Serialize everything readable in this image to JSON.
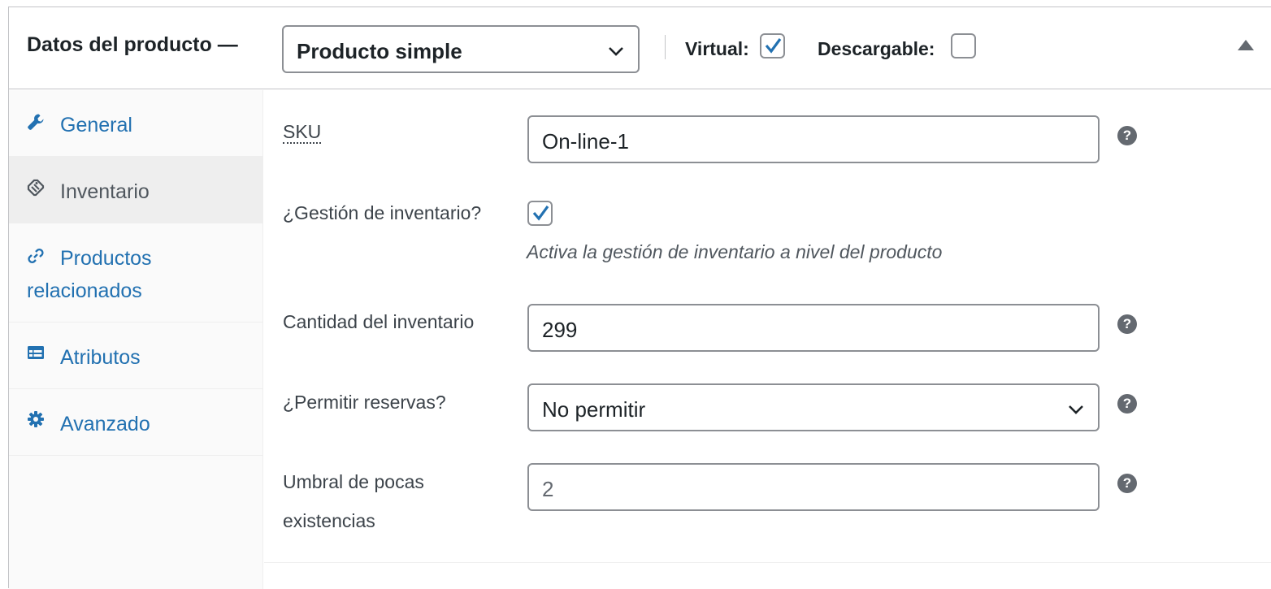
{
  "header": {
    "title": "Datos del producto —",
    "product_type": "Producto simple",
    "virtual_label": "Virtual:",
    "virtual_checked": true,
    "downloadable_label": "Descargable:",
    "downloadable_checked": false
  },
  "tabs": [
    {
      "label": "General",
      "icon": "wrench-icon",
      "active": false
    },
    {
      "label": "Inventario",
      "icon": "tag-icon",
      "active": true
    },
    {
      "label_line1": "Productos",
      "label_line2": "relacionados",
      "icon": "link-icon",
      "active": false
    },
    {
      "label": "Atributos",
      "icon": "list-view-icon",
      "active": false
    },
    {
      "label": "Avanzado",
      "icon": "gear-icon",
      "active": false
    }
  ],
  "form": {
    "sku": {
      "label": "SKU",
      "value": "On-line-1"
    },
    "manage_stock": {
      "label": "¿Gestión de inventario?",
      "checked": true,
      "description": "Activa la gestión de inventario a nivel del producto"
    },
    "stock_qty": {
      "label": "Cantidad del inventario",
      "value": "299"
    },
    "backorders": {
      "label": "¿Permitir reservas?",
      "value": "No permitir"
    },
    "low_stock": {
      "label_line1": "Umbral de pocas",
      "label_line2": "existencias",
      "value": "2"
    }
  },
  "colors": {
    "accent": "#2271b1",
    "border": "#8c8f94",
    "help": "#646970"
  }
}
